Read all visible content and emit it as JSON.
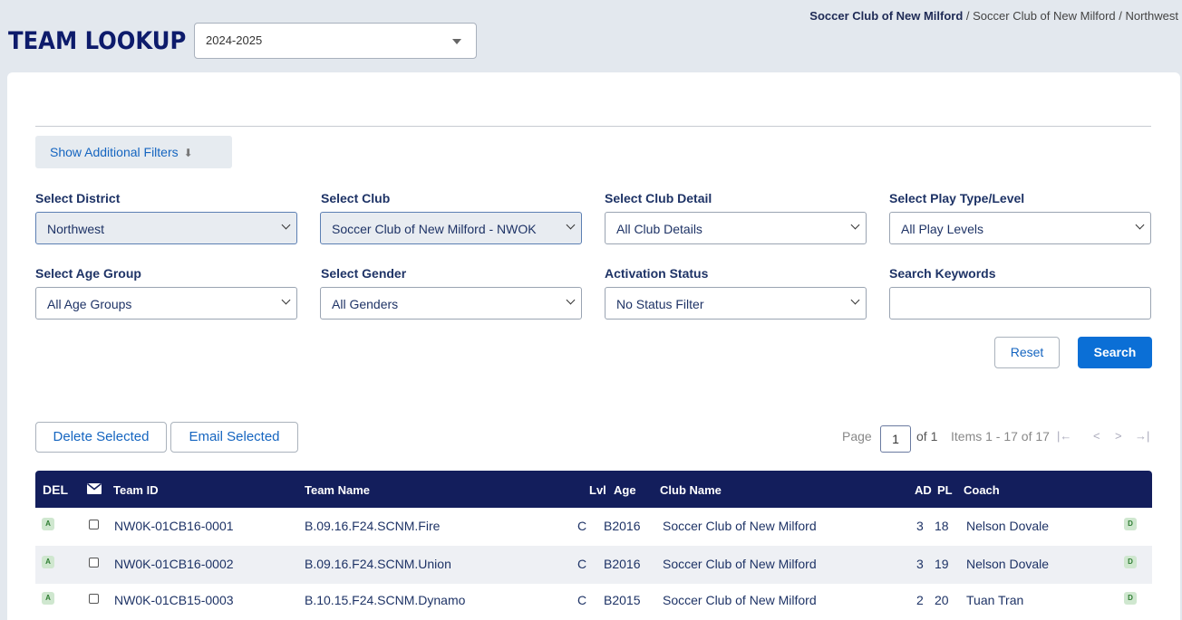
{
  "page_title": "TEAM LOOKUP",
  "season_select": {
    "value": "2024-2025"
  },
  "breadcrumb": {
    "current": "Soccer Club of New Milford",
    "rest": " / Soccer Club of New Milford / Northwest"
  },
  "filters_toggle": "Show Additional Filters",
  "filters": {
    "district": {
      "label": "Select District",
      "value": "Northwest"
    },
    "club": {
      "label": "Select Club",
      "value": "Soccer Club of New Milford - NWOK"
    },
    "club_detail": {
      "label": "Select Club Detail",
      "value": "All Club Details"
    },
    "play_type": {
      "label": "Select Play Type/Level",
      "value": "All Play Levels"
    },
    "age_group": {
      "label": "Select Age Group",
      "value": "All Age Groups"
    },
    "gender": {
      "label": "Select Gender",
      "value": "All Genders"
    },
    "activation": {
      "label": "Activation Status",
      "value": "No Status Filter"
    },
    "keywords": {
      "label": "Search Keywords",
      "value": ""
    }
  },
  "buttons": {
    "reset": "Reset",
    "search": "Search",
    "delete_selected": "Delete Selected",
    "email_selected": "Email Selected"
  },
  "pager": {
    "page_label": "Page",
    "page": "1",
    "of": "of 1",
    "items": "Items 1 - 17 of 17",
    "first": "|←",
    "prev": "<",
    "next": ">",
    "last": "→|"
  },
  "table": {
    "headers": {
      "del": "DEL",
      "team_id": "Team ID",
      "team_name": "Team Name",
      "lvl": "Lvl",
      "age": "Age",
      "club_name": "Club Name",
      "ad": "AD",
      "pl": "PL",
      "coach": "Coach"
    },
    "rows": [
      {
        "status": "A",
        "team_id": "NW0K-01CB16-0001",
        "team_name": "B.09.16.F24.SCNM.Fire",
        "lvl": "C",
        "age": "B2016",
        "club": "Soccer Club of New Milford",
        "ad": "3",
        "pl": "18",
        "coach": "Nelson Dovale",
        "action": "D"
      },
      {
        "status": "A",
        "team_id": "NW0K-01CB16-0002",
        "team_name": "B.09.16.F24.SCNM.Union",
        "lvl": "C",
        "age": "B2016",
        "club": "Soccer Club of New Milford",
        "ad": "3",
        "pl": "19",
        "coach": "Nelson Dovale",
        "action": "D"
      },
      {
        "status": "A",
        "team_id": "NW0K-01CB15-0003",
        "team_name": "B.10.15.F24.SCNM.Dynamo",
        "lvl": "C",
        "age": "B2015",
        "club": "Soccer Club of New Milford",
        "ad": "2",
        "pl": "20",
        "coach": "Tuan Tran",
        "action": "D"
      }
    ]
  }
}
